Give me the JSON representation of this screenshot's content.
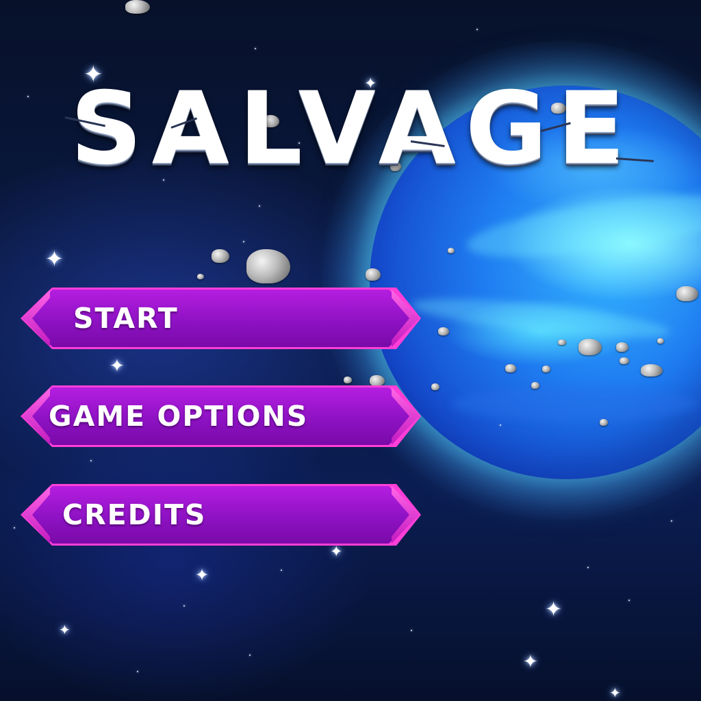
{
  "game": {
    "title": "SALVAGE"
  },
  "menu": {
    "items": [
      {
        "label": "START"
      },
      {
        "label": "GAME OPTIONS"
      },
      {
        "label": "CREDITS"
      }
    ]
  },
  "colors": {
    "button_fill": "#8e12c4",
    "button_border": "#ff3fd8",
    "planet": "#1e7af0",
    "space": "#07112a"
  },
  "icons": {
    "decor": [
      "planet",
      "asteroid",
      "star"
    ]
  }
}
